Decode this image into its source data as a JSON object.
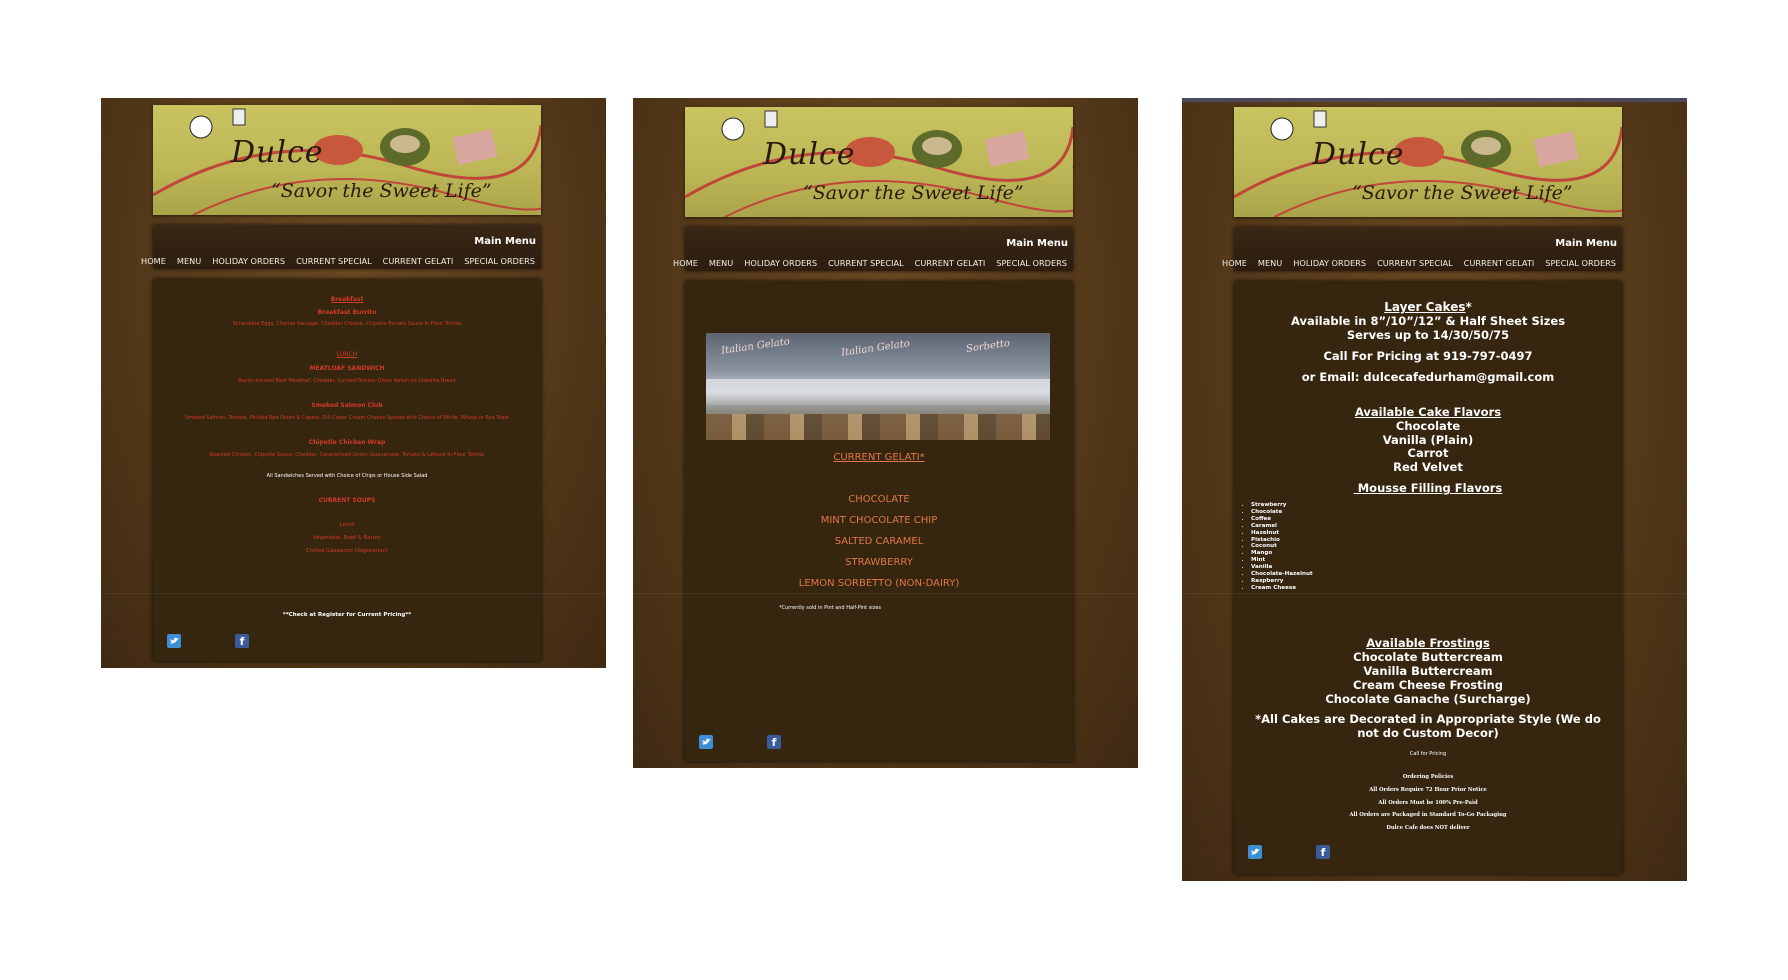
{
  "header": {
    "brand": "Dulce",
    "tagline": "“Savor the Sweet Life”",
    "menu_title": "Main Menu",
    "nav": [
      "HOME",
      "MENU",
      "HOLIDAY ORDERS",
      "CURRENT SPECIAL",
      "CURRENT GELATI",
      "SPECIAL ORDERS"
    ]
  },
  "social": {
    "twitter": "twitter-icon",
    "facebook_glyph": "f"
  },
  "colors": {
    "menu_red": "#d23b2a",
    "gelati_orange": "#e0774a",
    "background_brown": "#5a3d1c",
    "banner_olive": "#bcb656"
  },
  "menu_page": {
    "breakfast_heading": "Breakfast",
    "breakfast_item": "Breakfast Burrito",
    "breakfast_desc": "Scrambled Eggs, Chorizo Sausage, Cheddar Cheese, Chipotle-Tomato Sauce in Flour Tortilla",
    "lunch_heading": "LUNCH",
    "item1_name": "MEATLOAF SANDWICH",
    "item1_desc": "Bacon-Infused Beef Meatloaf, Cheddar, Curried-Tomato-Onion Relish on Ciabatta Bread",
    "item2_name": "Smoked Salmon Club",
    "item2_desc": "Smoked Salmon, Tomato, Pickled Red Onion & Capers, Dill-Caper Cream Cheese Spread with Choice of White, Wheat or Rye Toast",
    "item3_name": "Chipotle Chicken Wrap",
    "item3_desc": "Roasted Chicken, Chipotle Sauce, Cheddar, Caramelized Onion, Guacamole, Tomato & Lettuce in Flour Tortilla",
    "sandwich_note": "All Sandwiches Served with Choice of Chips or House Side Salad",
    "soups_heading": "CURRENT SOUPS",
    "soups": [
      "Lentil",
      "Vegetable, Beef & Barley",
      "Chilled Gazpacho (Vegetarian)"
    ],
    "pricing_note": "**Check at Register for Current Pricing**"
  },
  "gelati_page": {
    "heading": "CURRENT GELATI*",
    "flavors": [
      "CHOCOLATE",
      "MINT CHOCOLATE CHIP",
      "SALTED CARAMEL",
      "STRAWBERRY",
      "LEMON SORBETTO  (NON-DAIRY)"
    ],
    "footnote": "*Currently sold in Pint and Half-Pint sizes",
    "photo_signs": [
      "Italian Gelato",
      "Sorbetto"
    ]
  },
  "special_orders_page": {
    "layer_cakes_heading": "Layer Cakes",
    "layer_cakes_star": "*",
    "sizes": "Available in 8”/10”/12” & Half Sheet Sizes",
    "serves": "Serves up to 14/30/50/75",
    "call": "Call For Pricing at 919-797-0497",
    "email": "or Email:  dulcecafedurham@gmail.com",
    "cake_flavors_heading": "Available Cake Flavors",
    "cake_flavors": [
      "Chocolate",
      "Vanilla (Plain)",
      "Carrot",
      "Red Velvet"
    ],
    "mousse_heading": " Mousse Filling Flavors",
    "mousse_flavors": [
      "Strawberry",
      "Chocolate",
      "Coffee",
      "Caramel",
      "Hazelnut",
      "Pistachio",
      "Coconut",
      "Mango",
      "Mint",
      "Vanilla",
      "Chocolate-Hazelnut",
      "Raspberry",
      "Cream Cheese"
    ],
    "frostings_heading": "Available Frostings",
    "frostings": [
      "Chocolate Buttercream",
      "Vanilla Buttercream",
      "Cream Cheese Frosting",
      "Chocolate Ganache (Surcharge)"
    ],
    "decor_note": "*All Cakes are Decorated in Appropriate Style (We do not do Custom Decor)",
    "call_small": "Call for Pricing",
    "policies_heading": "Ordering Policies",
    "policies": [
      "All Orders Require 72 Hour Prior Notice",
      "All Orders Must be 100% Pre-Paid",
      "All Orders are Packaged  in Standard To-Go Packaging",
      "Dulce Cafe does NOT deliver"
    ]
  }
}
